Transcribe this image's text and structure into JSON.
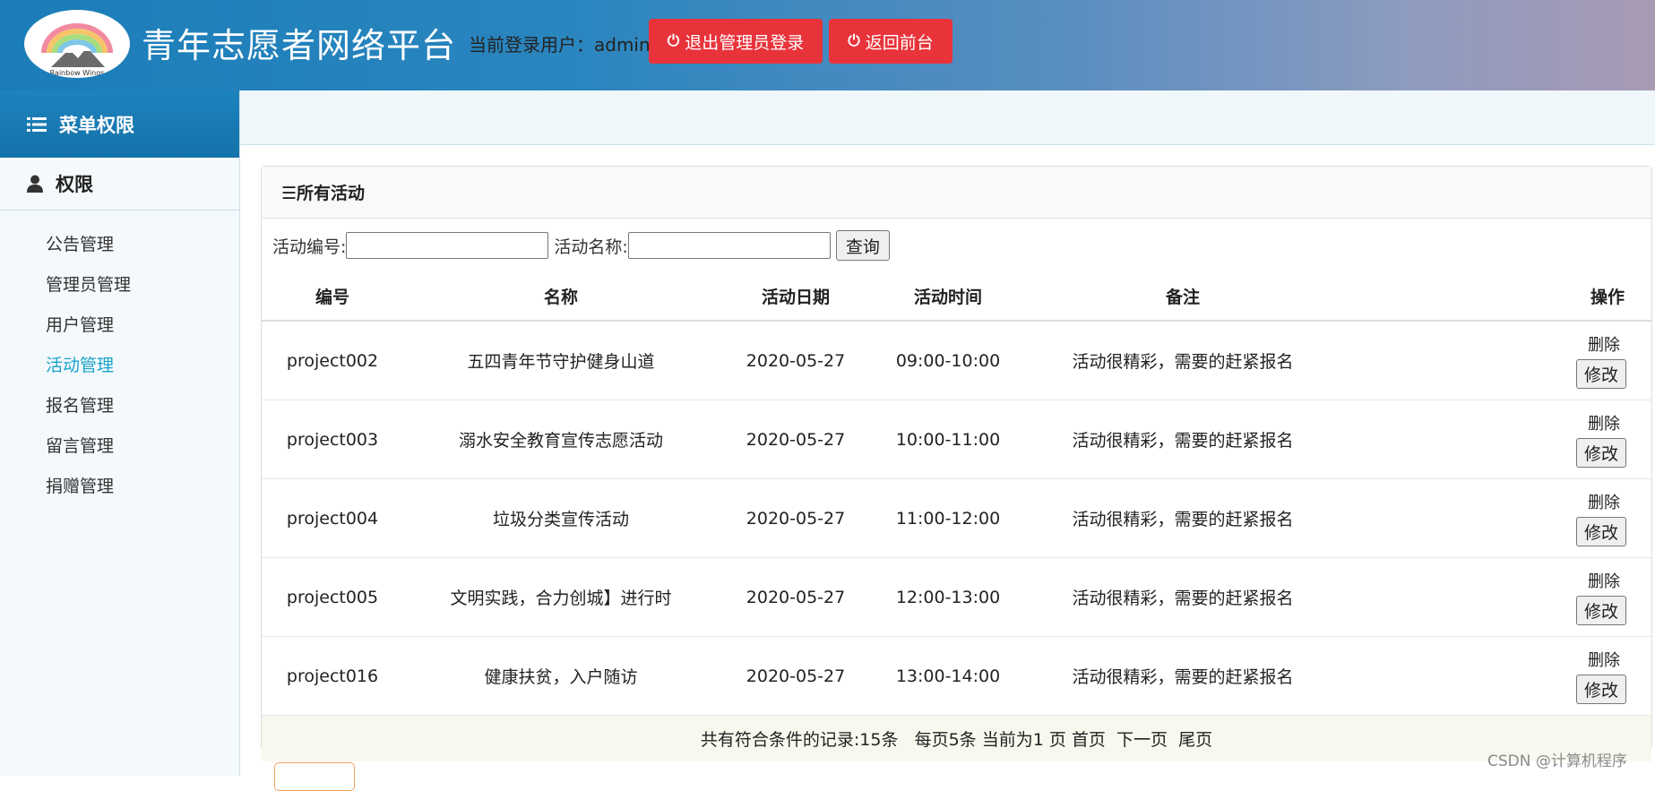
{
  "header": {
    "logo_text": "Rainbow Wings",
    "title": "青年志愿者网络平台",
    "login_label": "当前登录用户：",
    "username": "admin",
    "logout_label": "退出管理员登录",
    "front_label": "返回前台"
  },
  "sidebar": {
    "menu_title": "菜单权限",
    "group_title": "权限",
    "items": [
      {
        "label": "公告管理"
      },
      {
        "label": "管理员管理"
      },
      {
        "label": "用户管理"
      },
      {
        "label": "活动管理",
        "active": true
      },
      {
        "label": "报名管理"
      },
      {
        "label": "留言管理"
      },
      {
        "label": "捐赠管理"
      }
    ]
  },
  "panel": {
    "heading": "☰所有活动",
    "search": {
      "id_label": "活动编号:",
      "id_value": "",
      "name_label": "活动名称:",
      "name_value": "",
      "query_label": "查询"
    },
    "columns": [
      "编号",
      "名称",
      "活动日期",
      "活动时间",
      "备注",
      "操作"
    ],
    "rows": [
      {
        "id": "project002",
        "name": "五四青年节守护健身山道",
        "date": "2020-05-27",
        "time": "09:00-10:00",
        "note": "活动很精彩，需要的赶紧报名"
      },
      {
        "id": "project003",
        "name": "溺水安全教育宣传志愿活动",
        "date": "2020-05-27",
        "time": "10:00-11:00",
        "note": "活动很精彩，需要的赶紧报名"
      },
      {
        "id": "project004",
        "name": "垃圾分类宣传活动",
        "date": "2020-05-27",
        "time": "11:00-12:00",
        "note": "活动很精彩，需要的赶紧报名"
      },
      {
        "id": "project005",
        "name": "文明实践，合力创城】进行时",
        "date": "2020-05-27",
        "time": "12:00-13:00",
        "note": "活动很精彩，需要的赶紧报名"
      },
      {
        "id": "project016",
        "name": "健康扶贫，入户随访",
        "date": "2020-05-27",
        "time": "13:00-14:00",
        "note": "活动很精彩，需要的赶紧报名"
      }
    ],
    "row_actions": {
      "delete_label": "删除",
      "edit_label": "修改"
    },
    "pager": {
      "summary": "共有符合条件的记录:15条   每页5条 当前为1 页 ",
      "first": "首页",
      "next": "下一页",
      "last": "尾页"
    }
  },
  "watermark": "CSDN @计算机程序",
  "colors": {
    "header_start": "#1a7db8",
    "header_end": "#a99ab4",
    "button_red": "#e8333b",
    "active_nav": "#1aa2c9",
    "sidebar_bg": "#f4f9fc"
  }
}
